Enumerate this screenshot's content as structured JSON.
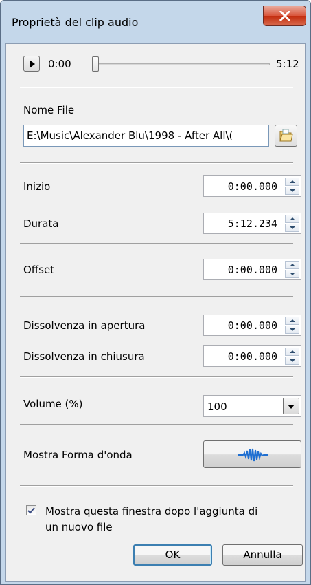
{
  "window": {
    "title": "Proprietà del clip audio",
    "close_icon": "close-icon"
  },
  "player": {
    "current_time": "0:00",
    "total_time": "5:12",
    "position_fraction": 0.0
  },
  "file": {
    "label": "Nome File",
    "value": "E:\\Music\\Alexander Blu\\1998 - After All\\("
  },
  "fields": {
    "inizio": {
      "label": "Inizio",
      "value": "0:00.000"
    },
    "durata": {
      "label": "Durata",
      "value": "5:12.234"
    },
    "offset": {
      "label": "Offset",
      "value": "0:00.000"
    },
    "fade_in": {
      "label": "Dissolvenza in apertura",
      "value": "0:00.000"
    },
    "fade_out": {
      "label": "Dissolvenza in chiusura",
      "value": "0:00.000"
    }
  },
  "volume": {
    "label": "Volume (%)",
    "value": "100"
  },
  "waveform": {
    "label": "Mostra Forma d'onda",
    "icon": "waveform-icon"
  },
  "option": {
    "line1": "Mostra questa finestra dopo l'aggiunta di",
    "line2": "un nuovo file",
    "checked": true
  },
  "buttons": {
    "ok": "OK",
    "cancel": "Annulla"
  },
  "colors": {
    "accent": "#3c7fb1",
    "wave": "#1f6fd1",
    "titlebar": "#c4d7ea",
    "close": "#c8381a"
  }
}
